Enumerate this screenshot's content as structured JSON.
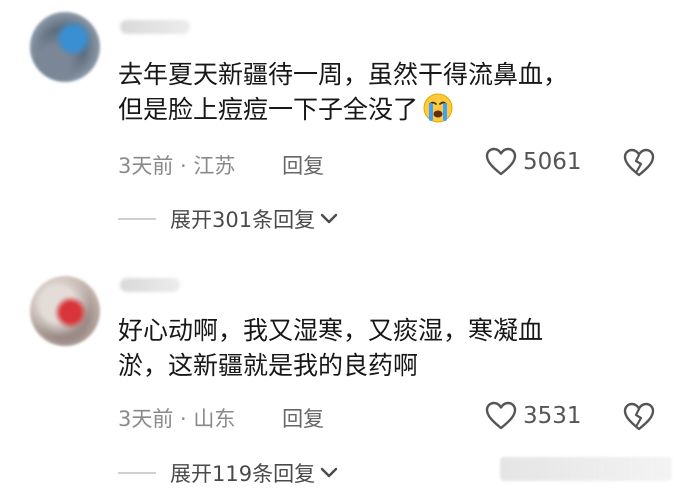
{
  "comments": [
    {
      "text_lines": [
        "去年夏天新疆待一周，虽然干得流鼻血，",
        "但是脸上痘痘一下子全没了"
      ],
      "emoji": "crying-face",
      "time_location": "3天前 · 江苏",
      "reply_label": "回复",
      "like_count": "5061",
      "expand_label": "展开301条回复"
    },
    {
      "text_lines": [
        "好心动啊，我又湿寒，又痰湿，寒凝血",
        "淤，这新疆就是我的良药啊"
      ],
      "time_location": "3天前 · 山东",
      "reply_label": "回复",
      "like_count": "3531",
      "expand_label": "展开119条回复"
    }
  ],
  "colors": {
    "text": "#171717",
    "meta": "#8a8a8a",
    "icon": "#555555",
    "divider": "#d0d0d0"
  }
}
